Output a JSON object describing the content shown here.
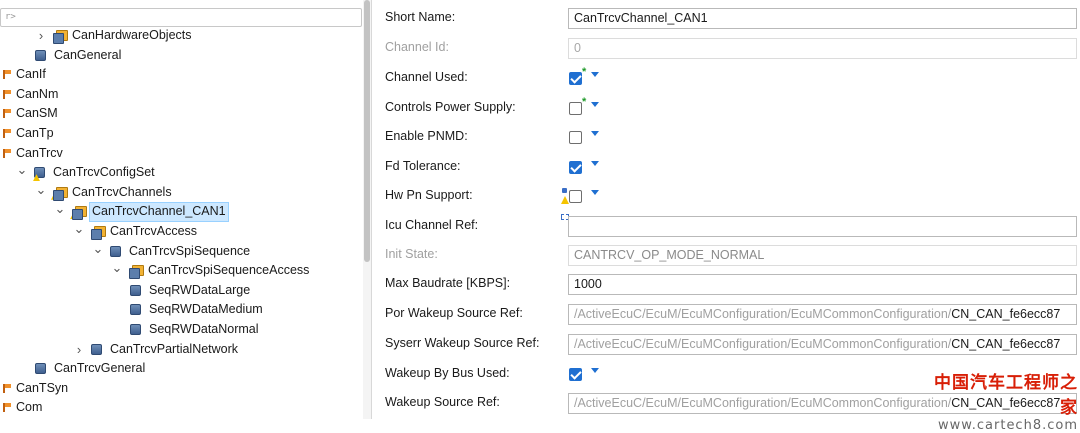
{
  "tree": {
    "filter_text": "r>",
    "rows": [
      {
        "label": "CanHardwareObjects",
        "icon": "folder-box-icon",
        "expander": "collapsed"
      },
      {
        "label": "CanGeneral",
        "icon": "module-icon",
        "expander": "none"
      },
      {
        "label": "CanIf",
        "icon": "flag-icon",
        "expander": "none"
      },
      {
        "label": "CanNm",
        "icon": "flag-icon",
        "expander": "none"
      },
      {
        "label": "CanSM",
        "icon": "flag-icon",
        "expander": "none"
      },
      {
        "label": "CanTp",
        "icon": "flag-icon",
        "expander": "none"
      },
      {
        "label": "CanTrcv",
        "icon": "flag-icon",
        "expander": "none"
      },
      {
        "label": "CanTrcvConfigSet",
        "icon": "module-warning-icon",
        "expander": "expanded"
      },
      {
        "label": "CanTrcvChannels",
        "icon": "folder-box-warning-icon",
        "expander": "expanded"
      },
      {
        "label": "CanTrcvChannel_CAN1",
        "icon": "folder-box-warning-icon",
        "expander": "expanded",
        "selected": true
      },
      {
        "label": "CanTrcvAccess",
        "icon": "folder-box-icon",
        "expander": "expanded"
      },
      {
        "label": "CanTrcvSpiSequence",
        "icon": "module-icon",
        "expander": "expanded"
      },
      {
        "label": "CanTrcvSpiSequenceAccess",
        "icon": "folder-box-icon",
        "expander": "expanded"
      },
      {
        "label": "SeqRWDataLarge",
        "icon": "module-icon",
        "expander": "none"
      },
      {
        "label": "SeqRWDataMedium",
        "icon": "module-icon",
        "expander": "none"
      },
      {
        "label": "SeqRWDataNormal",
        "icon": "module-icon",
        "expander": "none"
      },
      {
        "label": "CanTrcvPartialNetwork",
        "icon": "module-icon",
        "expander": "collapsed"
      },
      {
        "label": "CanTrcvGeneral",
        "icon": "module-icon",
        "expander": "none"
      },
      {
        "label": "CanTSyn",
        "icon": "flag-icon",
        "expander": "none"
      },
      {
        "label": "Com",
        "icon": "flag-icon",
        "expander": "none"
      }
    ]
  },
  "form": {
    "short_name": {
      "label": "Short Name:",
      "value": "CanTrcvChannel_CAN1"
    },
    "channel_id": {
      "label": "Channel Id:",
      "value": "0"
    },
    "channel_used": {
      "label": "Channel Used:",
      "checked": true
    },
    "controls_power_supply": {
      "label": "Controls Power Supply:",
      "checked": false
    },
    "enable_pnmd": {
      "label": "Enable PNMD:",
      "checked": false
    },
    "fd_tolerance": {
      "label": "Fd Tolerance:",
      "checked": true
    },
    "hw_pn_support": {
      "label": "Hw Pn Support:",
      "checked": false
    },
    "icu_channel_ref": {
      "label": "Icu Channel Ref:",
      "value": ""
    },
    "init_state": {
      "label": "Init State:",
      "value": "CANTRCV_OP_MODE_NORMAL"
    },
    "max_baudrate": {
      "label": "Max Baudrate [KBPS]:",
      "value": "1000"
    },
    "por_wakeup_source_ref": {
      "label": "Por Wakeup Source Ref:",
      "path": "/ActiveEcuC/EcuM/EcuMConfiguration/EcuMCommonConfiguration/",
      "target": "CN_CAN_fe6ecc87"
    },
    "syserr_wakeup_source_ref": {
      "label": "Syserr Wakeup Source Ref:",
      "path": "/ActiveEcuC/EcuM/EcuMConfiguration/EcuMCommonConfiguration/",
      "target": "CN_CAN_fe6ecc87"
    },
    "wakeup_by_bus_used": {
      "label": "Wakeup By Bus Used:",
      "checked": true
    },
    "wakeup_source_ref": {
      "label": "Wakeup Source Ref:",
      "path": "/ActiveEcuC/EcuM/EcuMConfiguration/EcuMCommonConfiguration/",
      "target": "CN_CAN_fe6ecc87"
    }
  },
  "watermark": {
    "cn": "中国汽车工程师之家",
    "url": "www.cartech8.com"
  },
  "colors": {
    "selection": "#cde8ff",
    "checkbox": "#1f6fd1",
    "watermark": "#d81e06"
  }
}
